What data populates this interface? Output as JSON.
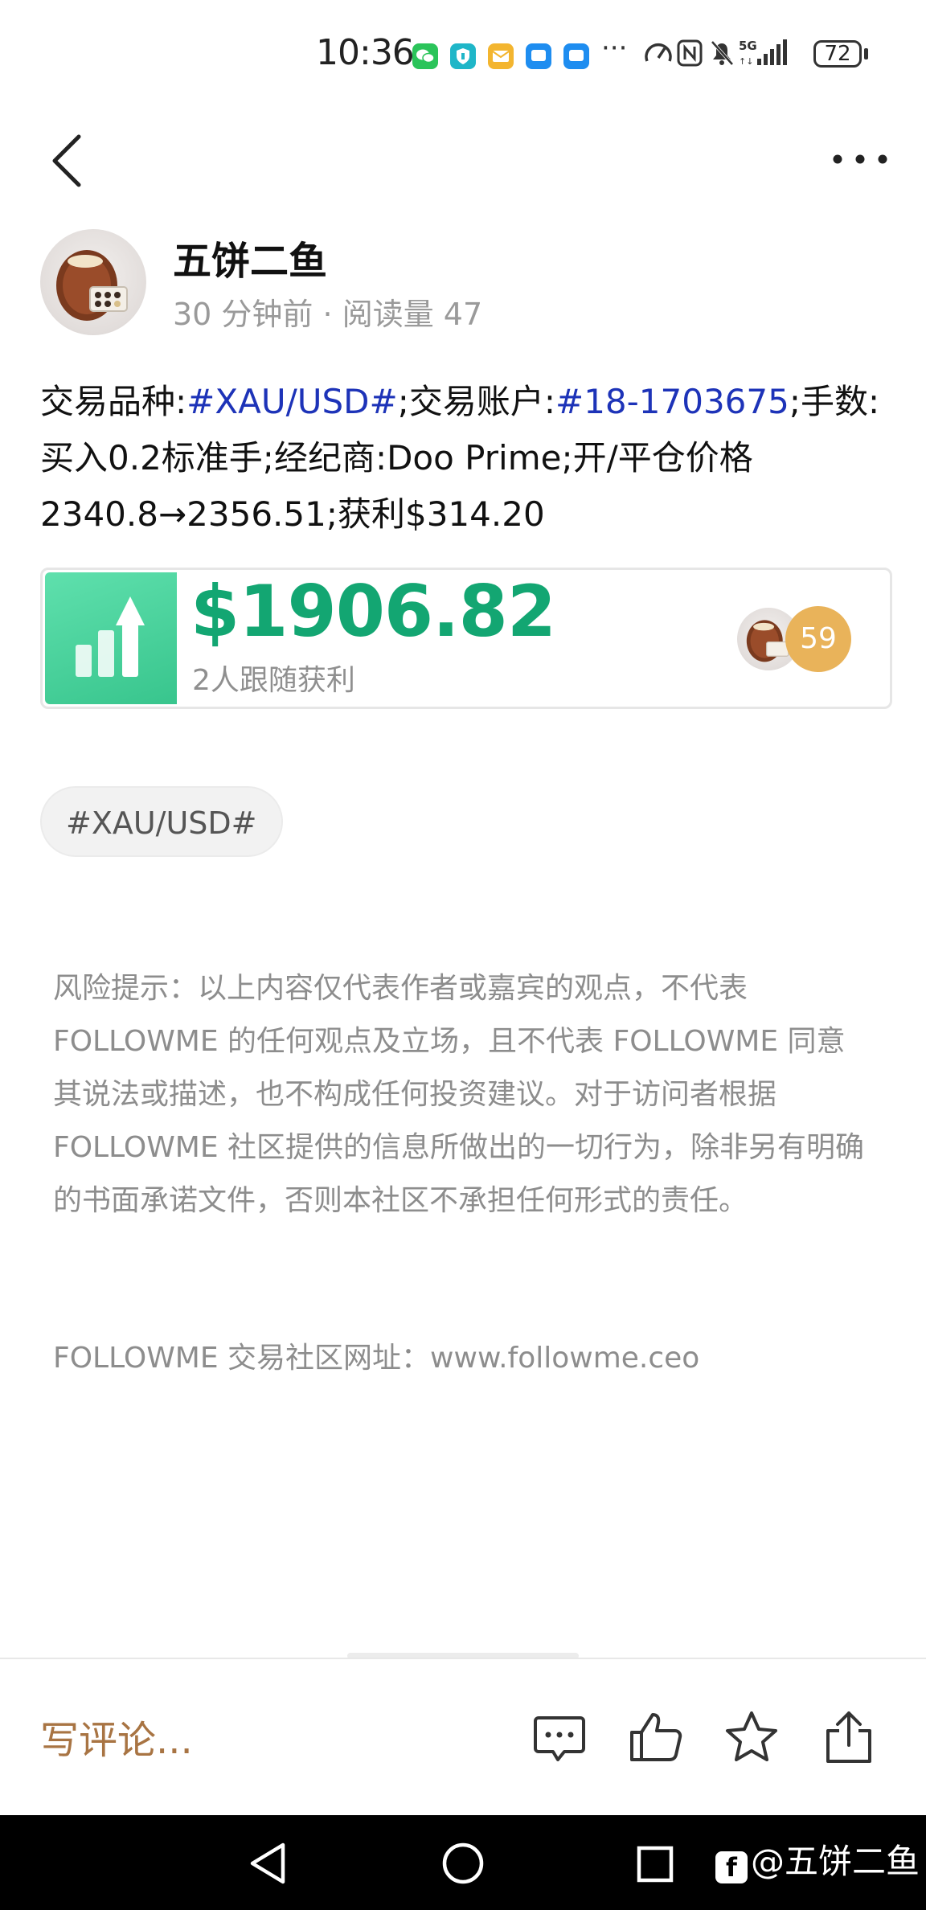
{
  "status_bar": {
    "time": "10:36",
    "overflow": "···",
    "battery": "72",
    "network": "5G",
    "notification_icons": [
      "wechat-icon",
      "shield-app-icon",
      "mail-app-icon",
      "message-app-icon",
      "message-app-icon"
    ]
  },
  "author": {
    "name": "五饼二鱼",
    "time_ago": "30 分钟前",
    "separator": "·",
    "views_label": "阅读量 47"
  },
  "post": {
    "seg1": "交易品种:",
    "tag_symbol": "#XAU/USD#",
    "seg2": ";交易账户:",
    "tag_account": "#18-1703675",
    "seg3": ";手数:买入0.2标准手;经纪商:Doo Prime;开/平仓价格2340.8→2356.51;获利$314.20"
  },
  "profit_card": {
    "amount": "$1906.82",
    "caption": "2人跟随获利",
    "follower_count": "59"
  },
  "tag_chip": "#XAU/USD#",
  "disclaimer": "风险提示：以上内容仅代表作者或嘉宾的观点，不代表 FOLLOWME 的任何观点及立场，且不代表 FOLLOWME 同意其说法或描述，也不构成任何投资建议。对于访问者根据 FOLLOWME 社区提供的信息所做出的一切行为，除非另有明确的书面承诺文件，否则本社区不承担任何形式的责任。",
  "site_line": "FOLLOWME 交易社区网址：www.followme.ceo",
  "action_bar": {
    "comment_placeholder": "写评论...",
    "icons": [
      "comment-icon",
      "like-icon",
      "favorite-star-icon",
      "share-icon"
    ]
  },
  "nav_bar": {
    "watermark_logo": "f",
    "watermark": "@五饼二鱼",
    "icons": [
      "back-triangle-icon",
      "home-circle-icon",
      "recents-square-icon"
    ]
  },
  "colors": {
    "hashtag": "#1d33b8",
    "profit": "#13a672",
    "comment_placeholder": "#a87443",
    "follower_badge": "#e9b35a"
  }
}
